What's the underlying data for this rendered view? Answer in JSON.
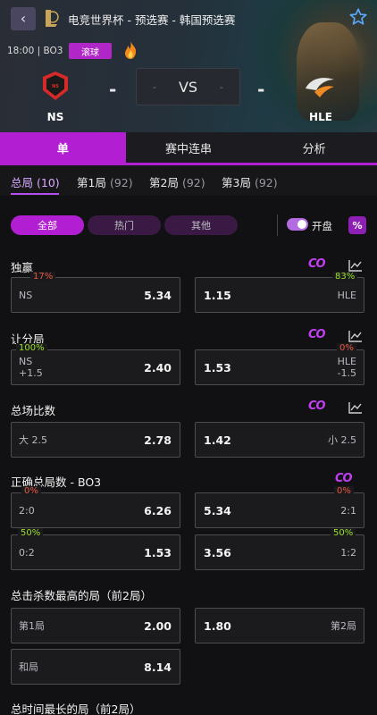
{
  "header": {
    "title": "电竞世界杯 - 预选赛 - 韩国预选赛",
    "match_info": "18:00 | BO3",
    "live_badge": "滚球",
    "vs": "VS",
    "home": {
      "name": "NS",
      "score": "-"
    },
    "away": {
      "name": "HLE",
      "score": "-"
    },
    "vs_home_mini": "-",
    "vs_away_mini": "-"
  },
  "main_tabs": [
    {
      "label": "单",
      "active": true
    },
    {
      "label": "赛中连串",
      "active": false
    },
    {
      "label": "分析",
      "active": false
    }
  ],
  "round_tabs": [
    {
      "label": "总局",
      "count": "(10)",
      "active": true
    },
    {
      "label": "第1局",
      "count": "(92)",
      "active": false
    },
    {
      "label": "第2局",
      "count": "(92)",
      "active": false
    },
    {
      "label": "第3局",
      "count": "(92)",
      "active": false
    }
  ],
  "filters": [
    {
      "label": "全部",
      "active": true
    },
    {
      "label": "热门",
      "active": false
    },
    {
      "label": "其他",
      "active": false
    }
  ],
  "toggle": {
    "label": "开盘",
    "on": true
  },
  "pct_button": "%",
  "markets": {
    "winner": {
      "title": "独赢",
      "left": {
        "pct": "17%",
        "label": "NS",
        "odds": "5.34"
      },
      "right": {
        "pct": "83%",
        "label": "HLE",
        "odds": "1.15"
      }
    },
    "handicap": {
      "title": "让分局",
      "left": {
        "pct": "100%",
        "label": "NS",
        "line": "+1.5",
        "odds": "2.40"
      },
      "right": {
        "pct": "0%",
        "label": "HLE",
        "line": "-1.5",
        "odds": "1.53"
      }
    },
    "total": {
      "title": "总场比数",
      "left": {
        "label": "大 2.5",
        "odds": "2.78"
      },
      "right": {
        "label": "小 2.5",
        "odds": "1.42"
      }
    },
    "correct_total": {
      "title": "正确总局数 - BO3",
      "row1": {
        "left": {
          "pct": "0%",
          "label": "2:0",
          "odds": "6.26"
        },
        "right": {
          "pct": "0%",
          "label": "2:1",
          "odds": "5.34"
        }
      },
      "row2": {
        "left": {
          "pct": "50%",
          "label": "0:2",
          "odds": "1.53"
        },
        "right": {
          "pct": "50%",
          "label": "1:2",
          "odds": "3.56"
        }
      }
    },
    "most_kills": {
      "title": "总击杀数最高的局（前2局）",
      "left": {
        "label": "第1局",
        "odds": "2.00"
      },
      "right": {
        "label": "第2局",
        "odds": "1.80"
      },
      "draw": {
        "label": "和局",
        "odds": "8.14"
      }
    },
    "longest_time": {
      "title": "总时间最长的局（前2局）"
    }
  },
  "icons": {
    "back": "chevron-left-icon",
    "favorite": "star-icon",
    "hot": "fire-icon",
    "stats": "chart-icon",
    "brand": "co-icon"
  },
  "colors": {
    "accent": "#b21ed2",
    "pct_down": "#e9573f",
    "pct_up": "#9be12a"
  }
}
